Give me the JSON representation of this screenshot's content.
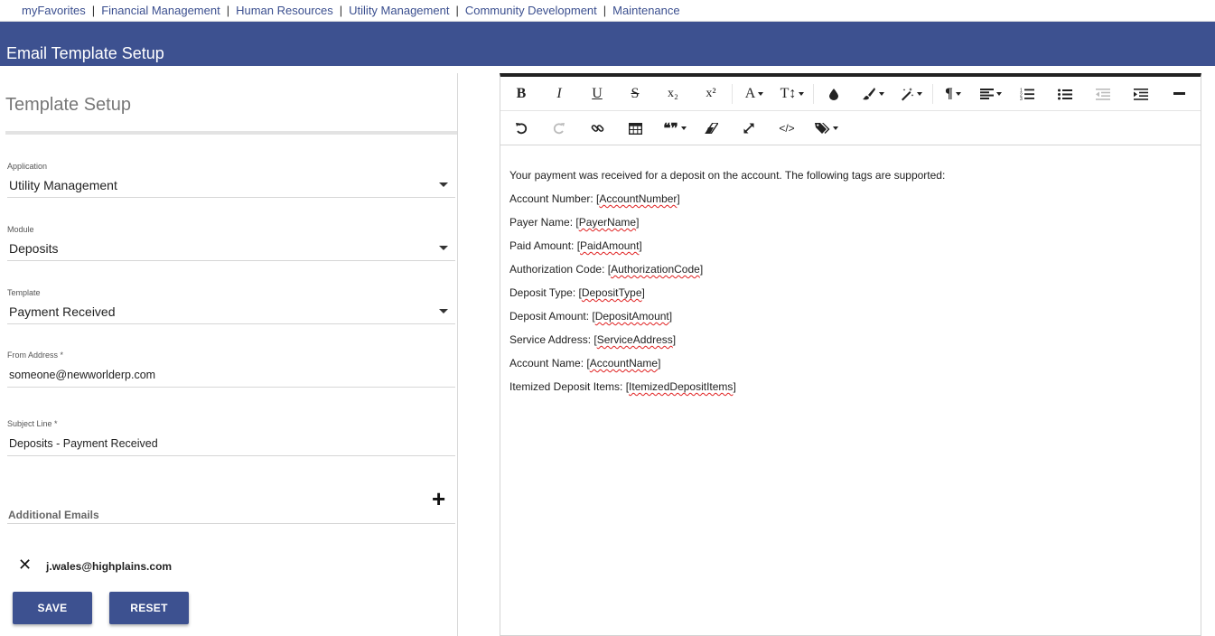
{
  "nav": {
    "items": [
      "myFavorites",
      "Financial Management",
      "Human Resources",
      "Utility Management",
      "Community Development",
      "Maintenance"
    ],
    "separator": "|"
  },
  "header": {
    "title": "Email Template Setup"
  },
  "form": {
    "section_title": "Template Setup",
    "application": {
      "label": "Application",
      "value": "Utility Management"
    },
    "module": {
      "label": "Module",
      "value": "Deposits"
    },
    "template": {
      "label": "Template",
      "value": "Payment Received"
    },
    "from_address": {
      "label": "From Address *",
      "value": "someone@newworlderp.com"
    },
    "subject_line": {
      "label": "Subject Line *",
      "value": "Deposits - Payment Received"
    },
    "additional_emails": {
      "label": "Additional Emails",
      "add_symbol": "+",
      "remove_symbol": "✕",
      "items": [
        "j.wales@highplains.com"
      ]
    },
    "save_label": "SAVE",
    "reset_label": "RESET"
  },
  "toolbar": {
    "bold": "B",
    "italic": "I",
    "underline": "U",
    "strike": "S",
    "subscript": "x₂",
    "superscript": "x²",
    "font_family": "A",
    "font_size": "T↕",
    "paragraph": "¶",
    "blockquote": "❝❞",
    "code_view": "</>"
  },
  "editor": {
    "lines": [
      {
        "prefix": "Your payment was received for a deposit on the account.  The following tags are supported:",
        "tag": ""
      },
      {
        "prefix": "Account Number: [",
        "tag": "AccountNumber",
        "suffix": "]"
      },
      {
        "prefix": "Payer Name: [",
        "tag": "PayerName",
        "suffix": "]"
      },
      {
        "prefix": "Paid Amount: [",
        "tag": "PaidAmount",
        "suffix": "]"
      },
      {
        "prefix": "Authorization Code: [",
        "tag": "AuthorizationCode",
        "suffix": "]"
      },
      {
        "prefix": "Deposit Type: [",
        "tag": "DepositType",
        "suffix": "]"
      },
      {
        "prefix": "Deposit Amount: [",
        "tag": "DepositAmount",
        "suffix": "]"
      },
      {
        "prefix": "Service Address: [",
        "tag": "ServiceAddress",
        "suffix": "]"
      },
      {
        "prefix": "Account Name: [",
        "tag": "AccountName",
        "suffix": "]"
      },
      {
        "prefix": "Itemized Deposit Items: [",
        "tag": "ItemizedDepositItems",
        "suffix": "]"
      }
    ]
  },
  "colors": {
    "brand": "#3d5190",
    "nav_link": "#3b4f8f",
    "spell_error": "#e02020"
  }
}
